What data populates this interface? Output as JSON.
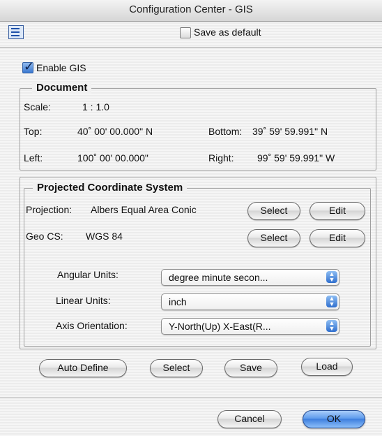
{
  "window": {
    "title": "Configuration Center - GIS"
  },
  "toolbar": {
    "save_default_label": "Save as default"
  },
  "enable_gis": {
    "label": "Enable GIS",
    "checked": true
  },
  "document": {
    "legend": "Document",
    "scale_label": "Scale:",
    "scale_value": "1 :  1.0",
    "top_label": "Top:",
    "top_value": "40˚ 00' 00.000\" N",
    "bottom_label": "Bottom:",
    "bottom_value": "39˚ 59' 59.991\" N",
    "left_label": "Left:",
    "left_value": "100˚ 00' 00.000\"",
    "right_label": "Right:",
    "right_value": "99˚ 59' 59.991\" W"
  },
  "pcs": {
    "legend": "Projected Coordinate System",
    "projection_label": "Projection:",
    "projection_value": "Albers Equal Area Conic",
    "geocs_label": "Geo CS:",
    "geocs_value": "WGS 84",
    "select_label": "Select",
    "edit_label": "Edit",
    "angular_label": "Angular Units:",
    "angular_value": "degree minute secon...",
    "linear_label": "Linear Units:",
    "linear_value": "inch",
    "axis_label": "Axis Orientation:",
    "axis_value": "Y-North(Up) X-East(R..."
  },
  "actions": {
    "auto_define": "Auto Define",
    "select": "Select",
    "save": "Save",
    "load": "Load"
  },
  "dialog": {
    "cancel": "Cancel",
    "ok": "OK"
  }
}
